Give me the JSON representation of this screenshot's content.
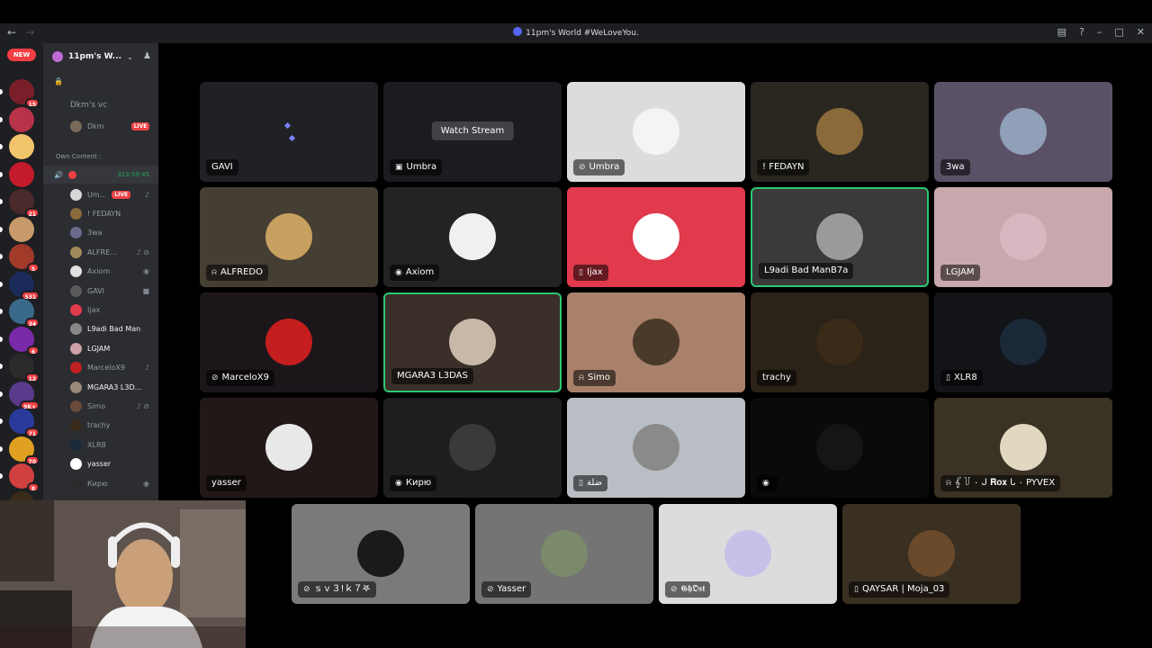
{
  "window": {
    "title": "11pm's World #WeLoveYou.",
    "back_icon": "arrow-left-icon",
    "forward_icon": "arrow-right-icon"
  },
  "rail": {
    "new_badge": "NEW",
    "servers": [
      {
        "badge": "15",
        "color": "#7a1f2a"
      },
      {
        "badge": "",
        "color": "#b8324a"
      },
      {
        "badge": "",
        "color": "#f2c46b"
      },
      {
        "badge": "",
        "color": "#c41a2a"
      },
      {
        "badge": "21",
        "color": "#4a2a2a"
      },
      {
        "badge": "",
        "color": "#c69a6a"
      },
      {
        "badge": "5",
        "color": "#a23a2a"
      },
      {
        "badge": "531",
        "color": "#1a2a5a"
      },
      {
        "badge": "34",
        "color": "#3a6a8a"
      },
      {
        "badge": "6",
        "color": "#7a2aa8"
      },
      {
        "badge": "12",
        "color": "#2a2a2a"
      },
      {
        "badge": "9K+",
        "color": "#5a3a8a"
      },
      {
        "badge": "71",
        "color": "#2a3a9a"
      },
      {
        "badge": "70",
        "color": "#e0a020"
      },
      {
        "badge": "8",
        "color": "#d04040"
      },
      {
        "badge": "",
        "color": "#3a2a1a"
      }
    ]
  },
  "sidebar": {
    "server_name": "11pm's W...",
    "dkm_vc": "Dkm's vc",
    "dkm_user": "Dkm",
    "category": "Own Content :",
    "call_timer": "323:59:45",
    "live_label": "LIVE",
    "members": [
      {
        "name": "Um...",
        "live": true,
        "white": false,
        "color": "#d8d8d8"
      },
      {
        "name": "! FEDAYN",
        "live": false,
        "white": false,
        "color": "#8a6a3a"
      },
      {
        "name": "3wa",
        "live": false,
        "white": false,
        "color": "#6a6a8a"
      },
      {
        "name": "ALFRE...",
        "live": false,
        "white": false,
        "color": "#a08a5a"
      },
      {
        "name": "Axiom",
        "live": false,
        "white": false,
        "color": "#e0e0e0"
      },
      {
        "name": "GAVI",
        "live": false,
        "white": false,
        "color": "#5a5a5a"
      },
      {
        "name": "Ijax",
        "live": false,
        "white": false,
        "color": "#e03a4a"
      },
      {
        "name": "L9adi Bad Man...",
        "live": false,
        "white": true,
        "color": "#888888"
      },
      {
        "name": "LGJAM",
        "live": false,
        "white": true,
        "color": "#d0a0a8"
      },
      {
        "name": "MarceloX9",
        "live": false,
        "white": false,
        "color": "#c02020"
      },
      {
        "name": "MGARA3 L3D...",
        "live": false,
        "white": true,
        "color": "#9a8a7a"
      },
      {
        "name": "Simo",
        "live": false,
        "white": false,
        "color": "#6a4a3a"
      },
      {
        "name": "trachy",
        "live": false,
        "white": false,
        "color": "#3a2a1a"
      },
      {
        "name": "XLR8",
        "live": false,
        "white": false,
        "color": "#1a2a3a"
      },
      {
        "name": "yasser",
        "live": false,
        "white": true,
        "color": "#ffffff"
      },
      {
        "name": "Кирю",
        "live": false,
        "white": false,
        "color": "#2a2a2a"
      }
    ]
  },
  "tiles": [
    {
      "name": "GAVI",
      "icon": "",
      "bg": "#202124",
      "pfp": "",
      "sel": false,
      "watch": false
    },
    {
      "name": "Umbra",
      "icon": "monitor-icon",
      "bg": "#1b1c1f",
      "pfp": "",
      "sel": false,
      "watch": true
    },
    {
      "name": "Umbra",
      "icon": "mic-off-icon",
      "bg": "#dcdcdc",
      "pfp": "#f4f4f4",
      "sel": false,
      "watch": false
    },
    {
      "name": "! FEDAYN",
      "icon": "",
      "bg": "#2a2720",
      "pfp": "#8a6a3a",
      "sel": false,
      "watch": false
    },
    {
      "name": "3wa",
      "icon": "",
      "bg": "#5b5166",
      "pfp": "#8fa0b8",
      "sel": false,
      "watch": false
    },
    {
      "name": "ALFREDO",
      "icon": "deafened-icon",
      "bg": "#453f33",
      "pfp": "#c8a060",
      "sel": false,
      "watch": false
    },
    {
      "name": "Axiom",
      "icon": "eye-icon",
      "bg": "#232323",
      "pfp": "#f0f0f0",
      "sel": false,
      "watch": false
    },
    {
      "name": "Ijax",
      "icon": "mobile-icon",
      "bg": "#e13a4c",
      "pfp": "#ffffff",
      "sel": false,
      "watch": false
    },
    {
      "name": "L9adi Bad ManB7a",
      "icon": "",
      "bg": "#3a3a3a",
      "pfp": "#9a9a9a",
      "sel": true,
      "watch": false
    },
    {
      "name": "LGJAM",
      "icon": "",
      "bg": "#c9a8ad",
      "pfp": "#d8b8c0",
      "sel": false,
      "watch": false
    },
    {
      "name": "MarceloX9",
      "icon": "mic-off-icon",
      "bg": "#1c161b",
      "pfp": "#c41e1e",
      "sel": false,
      "watch": false
    },
    {
      "name": "MGARA3 L3DAS",
      "icon": "",
      "bg": "#3a3029",
      "pfp": "#c8b8a8",
      "sel": true,
      "watch": false
    },
    {
      "name": "Simo",
      "icon": "deafened-icon",
      "bg": "#a9806a",
      "pfp": "#4a3a2a",
      "sel": false,
      "watch": false
    },
    {
      "name": "trachy",
      "icon": "",
      "bg": "#2b2218",
      "pfp": "#3a2a18",
      "sel": false,
      "watch": false
    },
    {
      "name": "XLR8",
      "icon": "mobile-icon",
      "bg": "#121418",
      "pfp": "#1a2838",
      "sel": false,
      "watch": false
    },
    {
      "name": "yasser",
      "icon": "",
      "bg": "#221818",
      "pfp": "#e8e8e8",
      "sel": false,
      "watch": false
    },
    {
      "name": "Кирю",
      "icon": "eye-icon",
      "bg": "#1e1e1e",
      "pfp": "#3a3a3a",
      "sel": false,
      "watch": false
    },
    {
      "name": "ضلة",
      "icon": "mobile-icon",
      "bg": "#b8bec4",
      "pfp": "#8a8a8a",
      "sel": false,
      "watch": false
    },
    {
      "name": "",
      "icon": "eye-icon",
      "bg": "#0a0a0a",
      "pfp": "#151515",
      "sel": false,
      "watch": false
    },
    {
      "name": "𝄟 ꒦ ٠ ᒍ 𝐑𝐨𝐱 ᒐ ٠ PYVEX",
      "icon": "deafened-icon",
      "bg": "#3a3224",
      "pfp": "#e0d8c0",
      "sel": false,
      "watch": false
    },
    {
      "name": "ｓｖ３!ｋ７𖤐",
      "icon": "mic-off-icon",
      "bg": "#7a7a7a",
      "pfp": "#1a1a1a",
      "sel": false,
      "watch": false
    },
    {
      "name": "Yasser",
      "icon": "mic-off-icon",
      "bg": "#747474",
      "pfp": "#7a8a6a",
      "sel": false,
      "watch": false
    },
    {
      "name": "𝕲𝖍𝕺𝖘𝖙",
      "icon": "mic-off-icon",
      "bg": "#dcdcdc",
      "pfp": "#c8c0e8",
      "sel": false,
      "watch": false
    },
    {
      "name": "QAYSAR | Moja_03",
      "icon": "mobile-icon",
      "bg": "#3a3022",
      "pfp": "#6a4a2a",
      "sel": false,
      "watch": false
    }
  ],
  "watch_stream": "Watch Stream"
}
